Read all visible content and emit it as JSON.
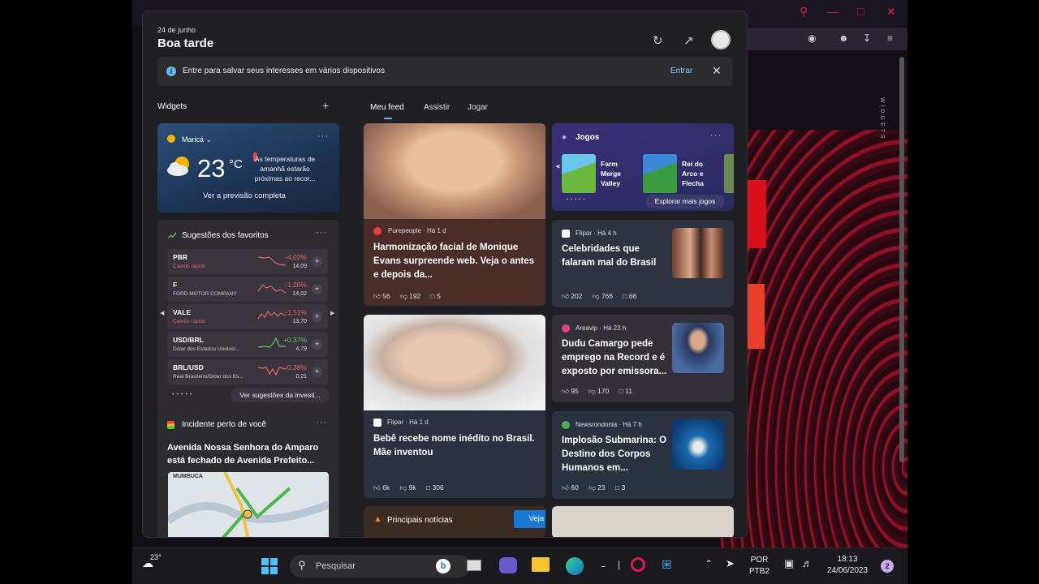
{
  "panel": {
    "date": "24 de junho",
    "greeting": "Boa tarde",
    "banner_text": "Entre para salvar seus interesses em vários dispositivos",
    "banner_signin": "Entrar",
    "widgets_label": "Widgets",
    "tabs": [
      "Meu feed",
      "Assistir",
      "Jogar"
    ]
  },
  "weather": {
    "location": "Maricá",
    "temp": "23",
    "unit": "°C",
    "message": "As temperaturas de amanhã estarão próximas ao recor...",
    "link": "Ver a previsão completa"
  },
  "stocks": {
    "title": "Sugestões dos favoritos",
    "rows": [
      {
        "sym": "PBR",
        "sub": "Caindo rápido",
        "chg": "-4,02%",
        "price": "14,09",
        "color": "#e06070"
      },
      {
        "sym": "F",
        "sub": "FORD MOTOR COMPANY",
        "chg": "-1,20%",
        "price": "14,02",
        "color": "#e06070"
      },
      {
        "sym": "VALE",
        "sub": "Caindo rápido",
        "chg": "-1,51%",
        "price": "13,70",
        "color": "#e06070"
      },
      {
        "sym": "USD/BRL",
        "sub": "Dólar dos Estados Unidos/...",
        "chg": "+0,37%",
        "price": "4,79",
        "color": "#5cc86c"
      },
      {
        "sym": "BRL/USD",
        "sub": "Real Brasileiro/Dólar dos Es...",
        "chg": "-0,38%",
        "price": "0,21",
        "color": "#e06070"
      }
    ],
    "more_button": "Ver sugestões da investi..."
  },
  "incident": {
    "title": "Incidente perto de você",
    "headline": "Avenida Nossa Senhora do Amparo está fechado de Avenida Prefeito...",
    "map_label": "MUMBUCA"
  },
  "news": {
    "n1": {
      "source": "Purepeople · Há 1 d",
      "headline": "Harmonização facial de Monique Evans surpreende web. Veja o antes e depois da...",
      "likes": "56",
      "dislikes": "192",
      "comments": "5"
    },
    "games": {
      "title": "Jogos",
      "g1": "Farm Merge Valley",
      "g2": "Rei do Arco e Flecha",
      "button": "Explorar mais jogos"
    },
    "n3": {
      "source": "Flipar · Há 4 h",
      "headline": "Celebridades que falaram mal do Brasil",
      "likes": "202",
      "dislikes": "766",
      "comments": "66"
    },
    "n4": {
      "source": "Flipar · Há 1 d",
      "headline": "Bebê recebe nome inédito no Brasil. Mãe inventou",
      "likes": "6k",
      "dislikes": "9k",
      "comments": "306"
    },
    "n5": {
      "source": "Areavip · Há 23 h",
      "headline": "Dudu Camargo pede emprego na Record e é exposto por emissora...",
      "likes": "95",
      "dislikes": "170",
      "comments": "11"
    },
    "n6": {
      "source": "Newsrondonia · Há 7 h",
      "headline": "Implosão Submarina: O Destino dos Corpos Humanos em...",
      "likes": "60",
      "dislikes": "23",
      "comments": "3"
    },
    "n7": {
      "title": "Principais notícias",
      "button": "Veja mais"
    }
  },
  "taskbar": {
    "weather_temp": "23°",
    "search": "Pesquisar",
    "lang1": "POR",
    "lang2": "PTB2",
    "time": "18:13",
    "date": "24/06/2023",
    "notifications": "2"
  },
  "browser": {
    "side_label": "WIDGETS"
  }
}
